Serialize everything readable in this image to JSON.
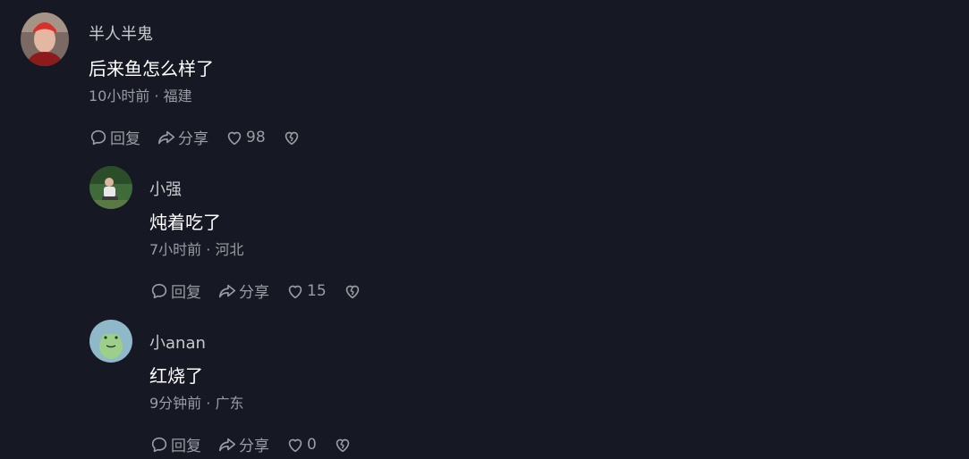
{
  "comments": [
    {
      "username": "半人半鬼",
      "text": "后来鱼怎么样了",
      "time": "10小时前",
      "location": "福建",
      "reply_label": "回复",
      "share_label": "分享",
      "likes": "98"
    },
    {
      "username": "小强",
      "text": "炖着吃了",
      "time": "7小时前",
      "location": "河北",
      "reply_label": "回复",
      "share_label": "分享",
      "likes": "15"
    },
    {
      "username": "小anan",
      "text": "红烧了",
      "time": "9分钟前",
      "location": "广东",
      "reply_label": "回复",
      "share_label": "分享",
      "likes": "0"
    }
  ],
  "separator": " · ",
  "icons": {
    "reply": "comment-bubble-icon",
    "share": "share-arrow-icon",
    "like": "heart-icon",
    "dislike": "broken-heart-icon"
  },
  "colors": {
    "background": "#161823",
    "username": "#c8c9cc",
    "text": "#ffffff",
    "meta": "#9b9ca3"
  }
}
